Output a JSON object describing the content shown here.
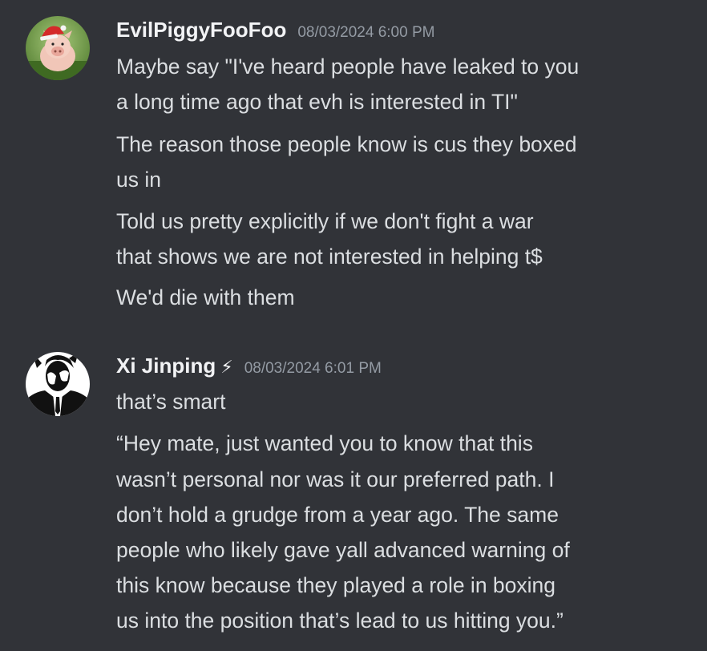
{
  "messages": [
    {
      "author": "EvilPiggyFooFoo",
      "timestamp": "08/03/2024 6:00 PM",
      "avatar": "pig-with-santa-hat",
      "lines": [
        "Maybe say \"I've heard people have leaked to you",
        "a long time ago that evh is interested in TI\"",
        "The reason those people know is cus they boxed",
        "us in",
        "Told us pretty explicitly if we don't fight a war",
        "that shows we are not interested in helping t$",
        "We'd die with them"
      ]
    },
    {
      "author": "Xi Jinping",
      "author_badge": "⚡",
      "timestamp": "08/03/2024 6:01 PM",
      "avatar": "black-white-figure-in-suit",
      "lines": [
        "that’s smart",
        "“Hey mate, just wanted you to know that this",
        "wasn’t personal nor was it our preferred path. I",
        "don’t hold a grudge from a year ago. The same",
        "people who likely gave yall advanced warning of",
        "this know because they played a role in boxing",
        "us into the position that’s lead to us hitting you.”"
      ]
    }
  ],
  "colors": {
    "background": "#313338",
    "username": "#f2f3f5",
    "message_text": "#dbdee1",
    "timestamp": "#949ba4"
  }
}
